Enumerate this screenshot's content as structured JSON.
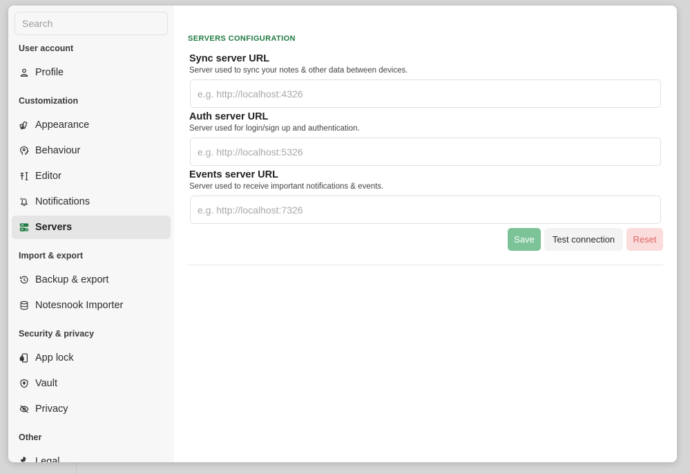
{
  "sidebar": {
    "search_placeholder": "Search",
    "sections": [
      {
        "title": "User account",
        "items": [
          {
            "label": "Profile",
            "icon": "profile-icon"
          }
        ]
      },
      {
        "title": "Customization",
        "items": [
          {
            "label": "Appearance",
            "icon": "palette-icon"
          },
          {
            "label": "Behaviour",
            "icon": "brain-icon"
          },
          {
            "label": "Editor",
            "icon": "editor-icon"
          },
          {
            "label": "Notifications",
            "icon": "bell-icon"
          },
          {
            "label": "Servers",
            "icon": "server-icon",
            "active": true
          }
        ]
      },
      {
        "title": "Import & export",
        "items": [
          {
            "label": "Backup & export",
            "icon": "backup-icon"
          },
          {
            "label": "Notesnook Importer",
            "icon": "database-import-icon"
          }
        ]
      },
      {
        "title": "Security & privacy",
        "items": [
          {
            "label": "App lock",
            "icon": "phone-lock-icon"
          },
          {
            "label": "Vault",
            "icon": "shield-icon"
          },
          {
            "label": "Privacy",
            "icon": "eye-off-icon"
          }
        ]
      },
      {
        "title": "Other",
        "items": [
          {
            "label": "Legal",
            "icon": "gavel-icon"
          }
        ]
      }
    ]
  },
  "main": {
    "section_title": "SERVERS CONFIGURATION",
    "fields": [
      {
        "label": "Sync server URL",
        "description": "Server used to sync your notes & other data between devices.",
        "placeholder": "e.g. http://localhost:4326",
        "value": ""
      },
      {
        "label": "Auth server URL",
        "description": "Server used for login/sign up and authentication.",
        "placeholder": "e.g. http://localhost:5326",
        "value": ""
      },
      {
        "label": "Events server URL",
        "description": "Server used to receive important notifications & events.",
        "placeholder": "e.g. http://localhost:7326",
        "value": ""
      }
    ],
    "buttons": {
      "save": "Save",
      "test": "Test connection",
      "reset": "Reset"
    }
  },
  "colors": {
    "accent": "#1f7a41",
    "save_button": "#7cc397",
    "reset_text": "#e06464",
    "reset_bg": "#fbdcdc"
  }
}
